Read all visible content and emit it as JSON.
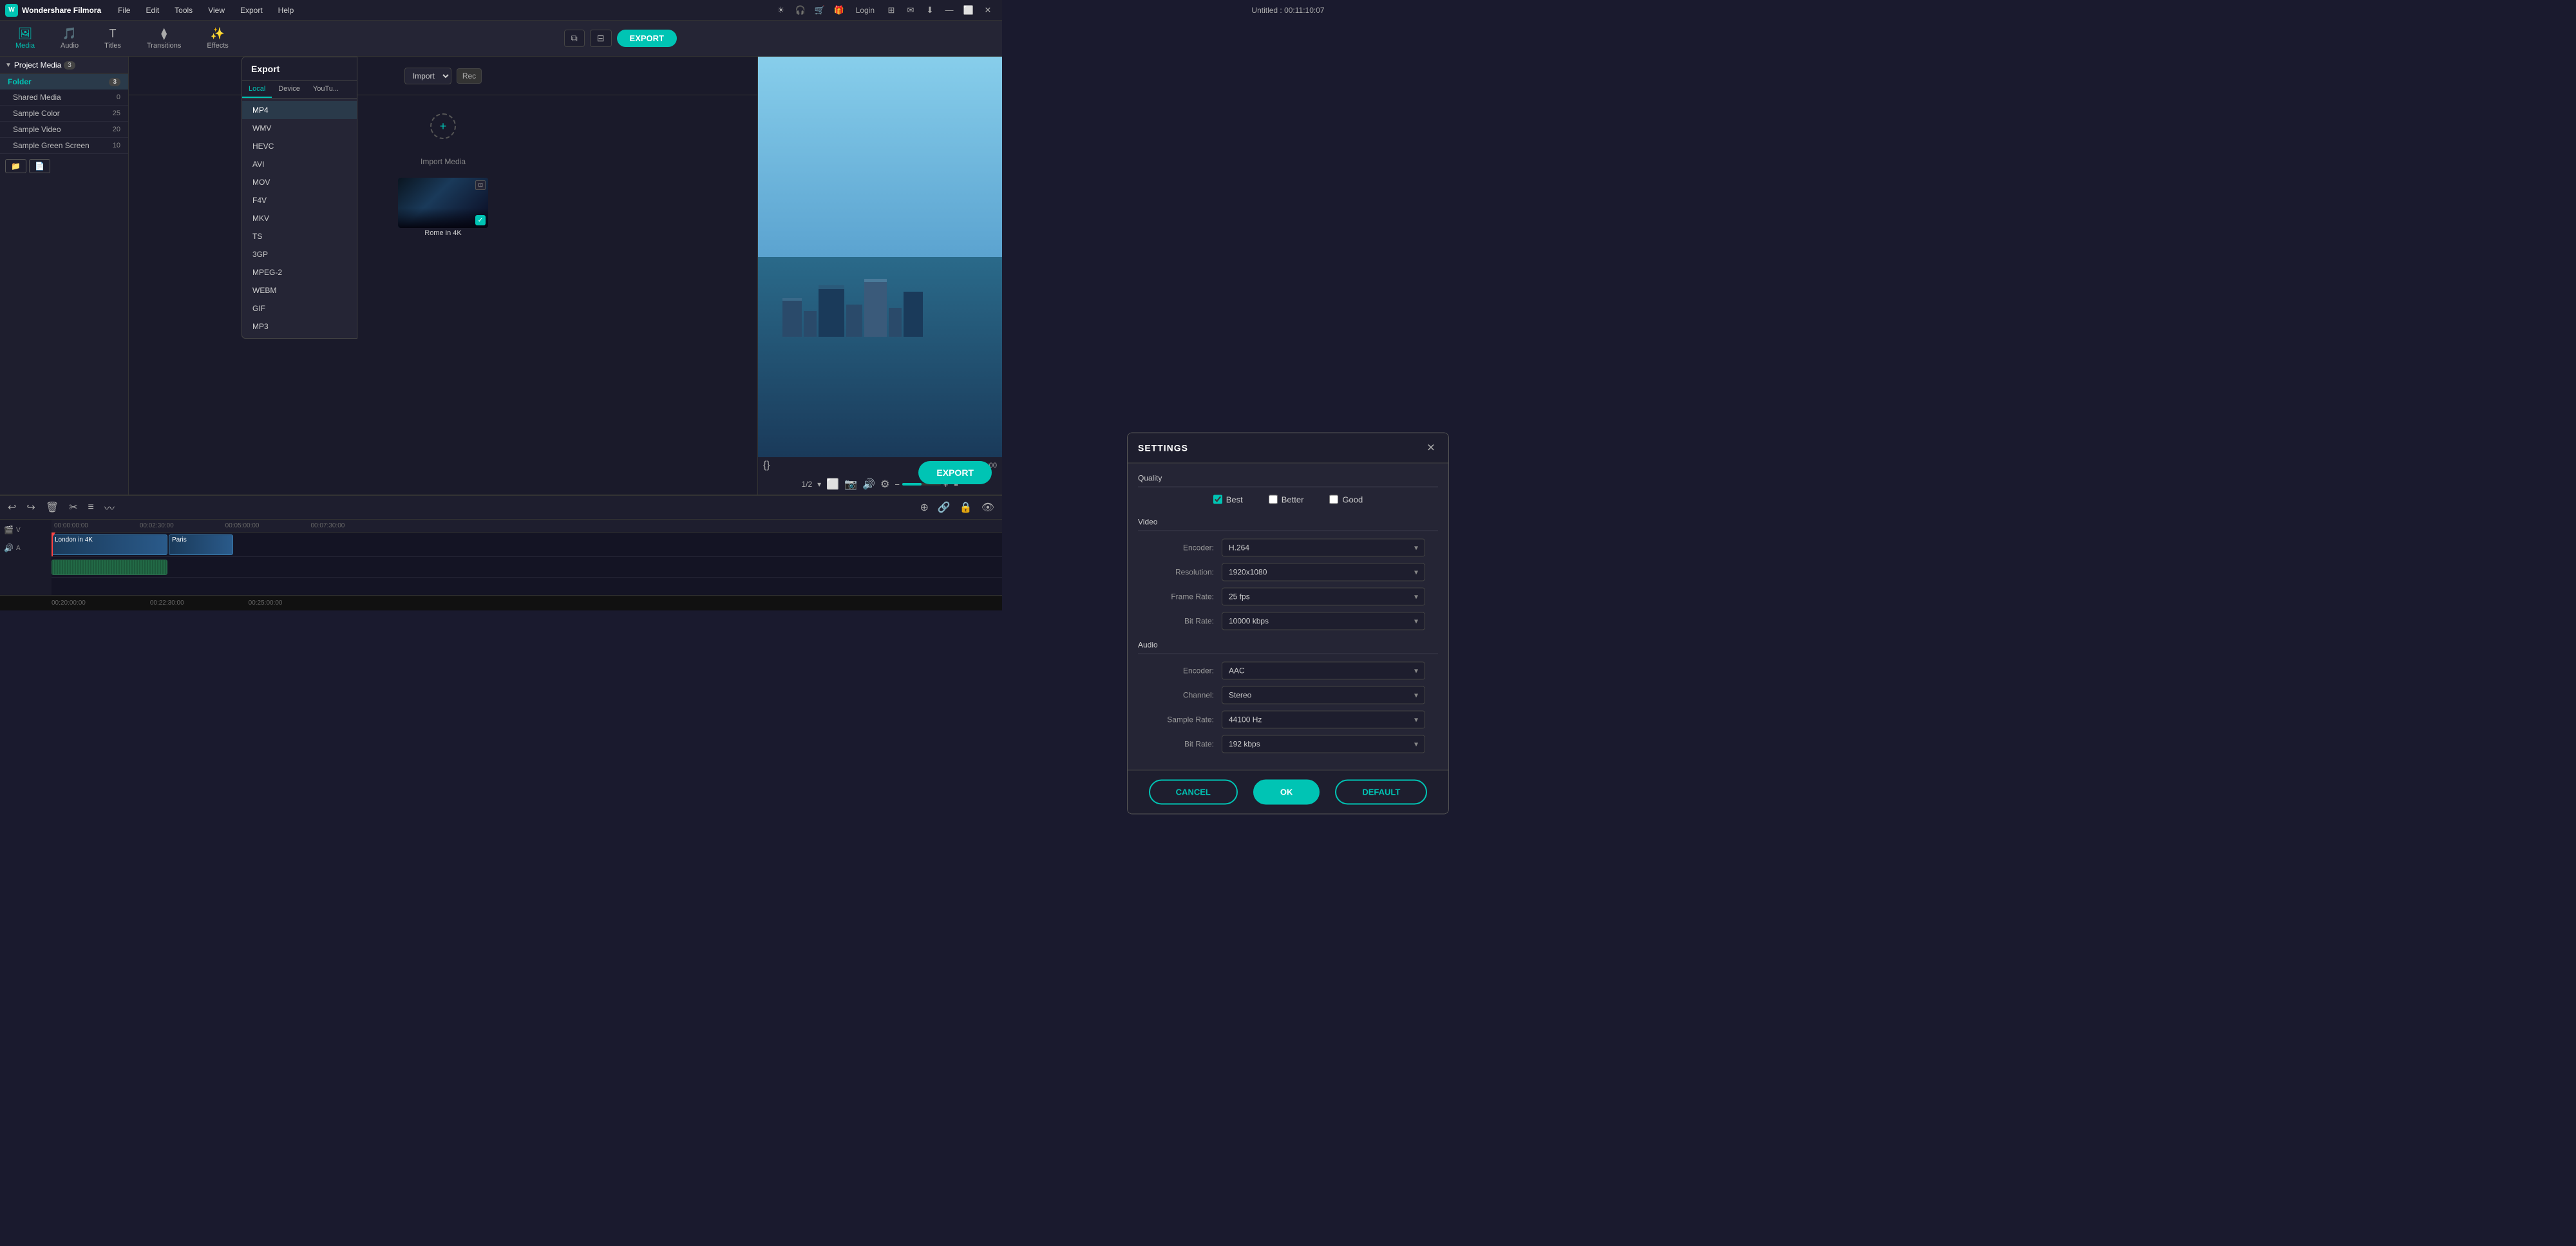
{
  "app": {
    "title": "Wondershare Filmora",
    "document_title": "Untitled : 00:11:10:07"
  },
  "title_bar": {
    "menu_items": [
      "File",
      "Edit",
      "Tools",
      "View",
      "Export",
      "Help"
    ],
    "window_controls": [
      "minimize",
      "maximize",
      "close"
    ]
  },
  "toolbar": {
    "items": [
      {
        "id": "media",
        "label": "Media",
        "active": true
      },
      {
        "id": "audio",
        "label": "Audio",
        "active": false
      },
      {
        "id": "titles",
        "label": "Titles",
        "active": false
      },
      {
        "id": "transitions",
        "label": "Transitions",
        "active": false
      },
      {
        "id": "effects",
        "label": "Effects",
        "active": false
      }
    ],
    "export_label": "EXPORT"
  },
  "left_panel": {
    "project_media": {
      "label": "Project Media",
      "count": 3
    },
    "folder": {
      "label": "Folder",
      "count": 3
    },
    "items": [
      {
        "label": "Shared Media",
        "count": 0
      },
      {
        "label": "Sample Color",
        "count": 25
      },
      {
        "label": "Sample Video",
        "count": 20
      },
      {
        "label": "Sample Green Screen",
        "count": 10
      }
    ],
    "import_label": "Import",
    "import_media_label": "Import Media"
  },
  "media_grid": {
    "thumbnail": {
      "label": "Rome in 4K"
    }
  },
  "preview": {
    "timecode": "1/2",
    "time_display": "00:00:00:00"
  },
  "timeline": {
    "ruler_marks": [
      "00:00:00:00",
      "00:02:30:00"
    ],
    "clips": [
      {
        "label": "London in 4K"
      },
      {
        "label": "Paris"
      }
    ],
    "bottom_marks": [
      "00:20:00:00",
      "00:22:30:00",
      "00:25:00:00"
    ]
  },
  "export_panel": {
    "title": "Export",
    "tabs": [
      {
        "id": "local",
        "label": "Local",
        "active": true
      },
      {
        "id": "device",
        "label": "Device",
        "active": false
      },
      {
        "id": "youtube",
        "label": "YouTu...",
        "active": false
      }
    ],
    "formats": [
      {
        "id": "mp4",
        "label": "MP4",
        "active": true
      },
      {
        "id": "wmv",
        "label": "WMV",
        "active": false
      },
      {
        "id": "hevc",
        "label": "HEVC",
        "active": false
      },
      {
        "id": "avi",
        "label": "AVI",
        "active": false
      },
      {
        "id": "mov",
        "label": "MOV",
        "active": false
      },
      {
        "id": "f4v",
        "label": "F4V",
        "active": false
      },
      {
        "id": "mkv",
        "label": "MKV",
        "active": false
      },
      {
        "id": "ts",
        "label": "TS",
        "active": false
      },
      {
        "id": "3gp",
        "label": "3GP",
        "active": false
      },
      {
        "id": "mpeg2",
        "label": "MPEG-2",
        "active": false
      },
      {
        "id": "webm",
        "label": "WEBM",
        "active": false
      },
      {
        "id": "gif",
        "label": "GIF",
        "active": false
      },
      {
        "id": "mp3",
        "label": "MP3",
        "active": false
      }
    ]
  },
  "settings_modal": {
    "title": "SETTINGS",
    "quality": {
      "label": "Quality",
      "options": [
        {
          "id": "best",
          "label": "Best",
          "checked": true
        },
        {
          "id": "better",
          "label": "Better",
          "checked": false
        },
        {
          "id": "good",
          "label": "Good",
          "checked": false
        }
      ]
    },
    "video": {
      "label": "Video",
      "encoder": {
        "label": "Encoder:",
        "value": "H.264"
      },
      "resolution": {
        "label": "Resolution:",
        "value": "1920x1080"
      },
      "frame_rate": {
        "label": "Frame Rate:",
        "value": "25 fps"
      },
      "bit_rate": {
        "label": "Bit Rate:",
        "value": "10000 kbps"
      }
    },
    "audio": {
      "label": "Audio",
      "encoder": {
        "label": "Encoder:",
        "value": "AAC"
      },
      "channel": {
        "label": "Channel:",
        "value": "Stereo"
      },
      "sample_rate": {
        "label": "Sample Rate:",
        "value": "44100 Hz"
      },
      "bit_rate": {
        "label": "Bit Rate:",
        "value": "192 kbps"
      }
    },
    "buttons": {
      "cancel": "CANCEL",
      "ok": "OK",
      "default": "DEFAULT"
    }
  },
  "right_panel": {
    "export_button": "EXPORT"
  }
}
